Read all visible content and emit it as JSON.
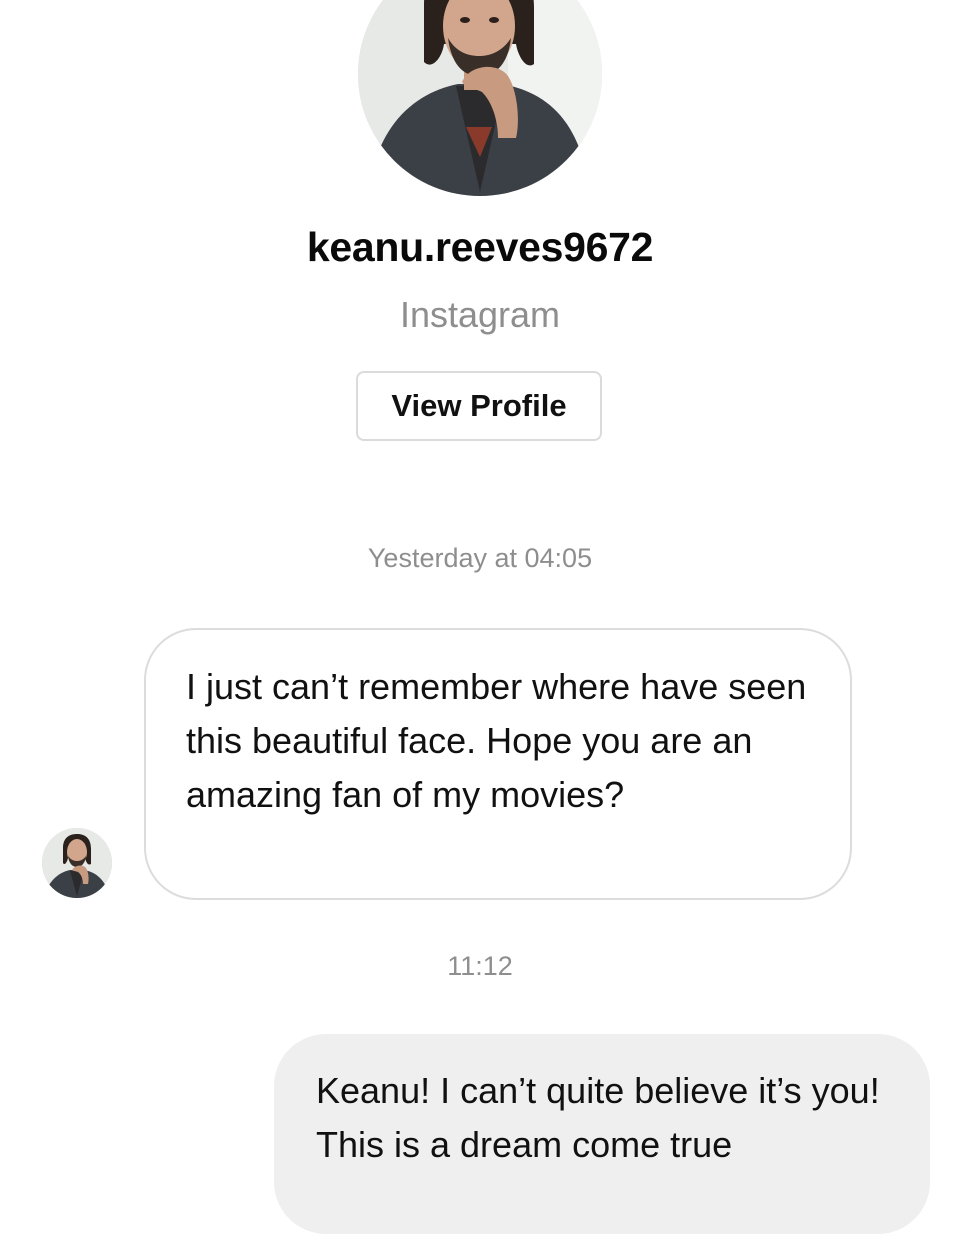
{
  "header": {
    "username": "keanu.reeves9672",
    "platform": "Instagram",
    "view_profile_label": "View Profile",
    "avatar_icon": "profile-photo-icon"
  },
  "thread": {
    "timestamps": [
      "Yesterday at 04:05",
      "11:12"
    ],
    "messages": [
      {
        "sender": "them",
        "text": "I just can’t remember where have seen this beautiful face. Hope you are an amazing fan of my movies?"
      },
      {
        "sender": "me",
        "text": "Keanu! I can’t quite believe it’s you! This is a dream come true"
      }
    ]
  },
  "colors": {
    "secondary_text": "#8e8e8e",
    "sent_bubble": "#efefef",
    "received_border": "#dcdcdc",
    "button_border": "#dbdbdb"
  }
}
